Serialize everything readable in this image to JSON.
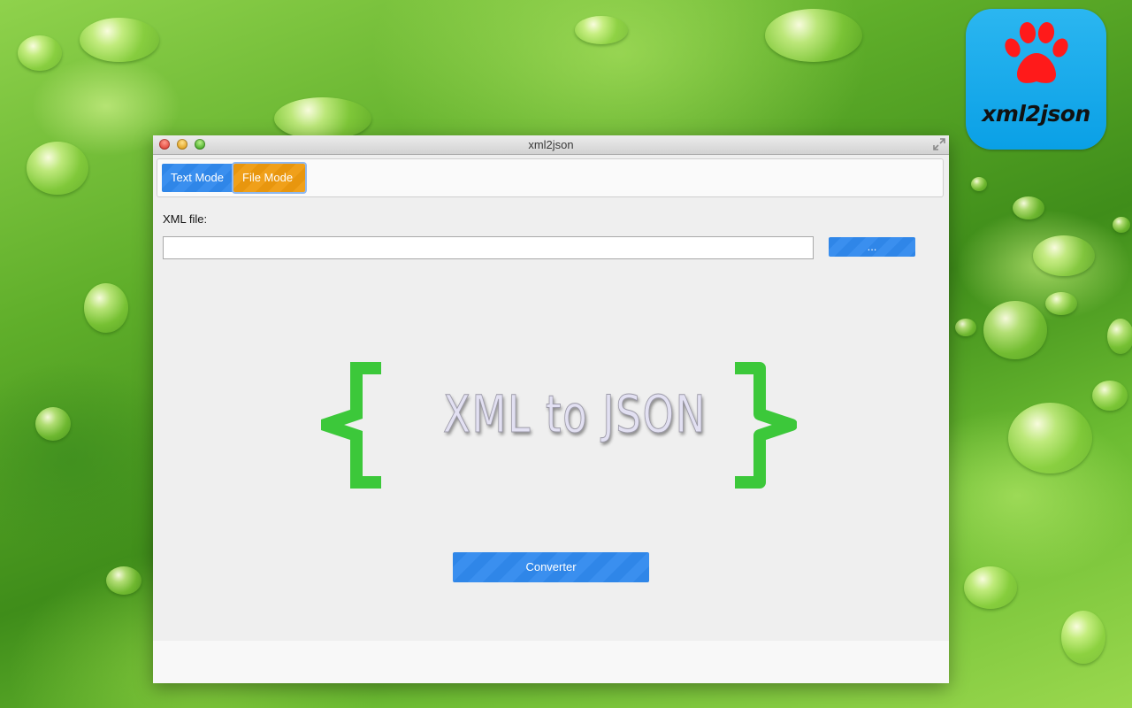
{
  "window": {
    "title": "xml2json"
  },
  "app_icon": {
    "label": "xml2json",
    "paw_color": "#ff1a1a",
    "background": "#0aa0e6"
  },
  "toolbar": {
    "text_mode_label": "Text Mode",
    "file_mode_label": "File Mode",
    "active_mode": "File Mode"
  },
  "form": {
    "xml_file_label": "XML file:",
    "xml_file_value": "",
    "browse_label": "..."
  },
  "hero": {
    "title": "XML to JSON",
    "brace_color": "#3cc83a"
  },
  "actions": {
    "convert_label": "Converter"
  },
  "colors": {
    "accent_blue": "#2f86e8",
    "accent_orange": "#e8960e"
  }
}
